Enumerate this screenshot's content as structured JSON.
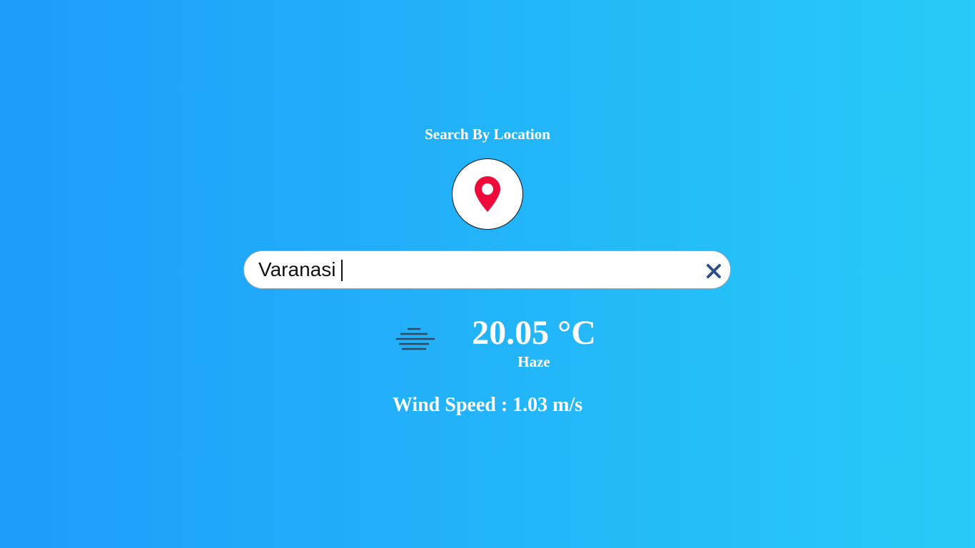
{
  "header": {
    "title": "Search By Location"
  },
  "locate_button": {
    "icon": "map-pin-icon",
    "icon_color": "#ee0b3c"
  },
  "search": {
    "value": "Varanasi",
    "clear_icon": "close-icon",
    "clear_icon_color": "#2f4f86"
  },
  "weather": {
    "icon": "haze-icon",
    "temperature": "20.05 °C",
    "condition": "Haze"
  },
  "wind": {
    "text": "Wind Speed : 1.03 m/s"
  },
  "colors": {
    "background_start": "#1e9cfb",
    "background_end": "#27cbf7",
    "text": "#ffffff"
  }
}
